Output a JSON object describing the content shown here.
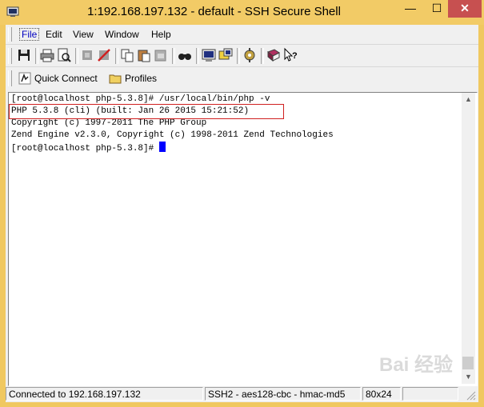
{
  "window": {
    "title": "1:192.168.197.132 - default - SSH Secure Shell",
    "minimize_glyph": "—",
    "maximize_glyph": "☐",
    "close_glyph": "✕"
  },
  "menu": {
    "items": [
      {
        "label": "File"
      },
      {
        "label": "Edit"
      },
      {
        "label": "View"
      },
      {
        "label": "Window"
      },
      {
        "label": "Help"
      }
    ]
  },
  "quickbar": {
    "quick_connect": "Quick Connect",
    "profiles": "Profiles"
  },
  "terminal": {
    "lines": [
      "[root@localhost php-5.3.8]# /usr/local/bin/php -v",
      "PHP 5.3.8 (cli) (built: Jan 26 2015 15:21:52)",
      "Copyright (c) 1997-2011 The PHP Group",
      "Zend Engine v2.3.0, Copyright (c) 1998-2011 Zend Technologies",
      "[root@localhost php-5.3.8]# "
    ],
    "cursor_color": "#0000ff",
    "highlight_color": "#d02020"
  },
  "status": {
    "connection": "Connected to 192.168.197.132",
    "cipher": "SSH2 - aes128-cbc - hmac-md5",
    "size": "80x24"
  },
  "watermark": {
    "text": "Bai 经验"
  },
  "colors": {
    "frame": "#f0c860",
    "close": "#c75050"
  },
  "icons": {
    "toolbar": [
      "save-icon",
      "print-icon",
      "print-preview-icon",
      "connect-icon",
      "disconnect-icon",
      "copy-icon",
      "paste-icon",
      "paste-disabled-icon",
      "find-icon",
      "new-terminal-icon",
      "new-file-transfer-icon",
      "settings-icon",
      "help-book-icon",
      "context-help-icon"
    ]
  }
}
